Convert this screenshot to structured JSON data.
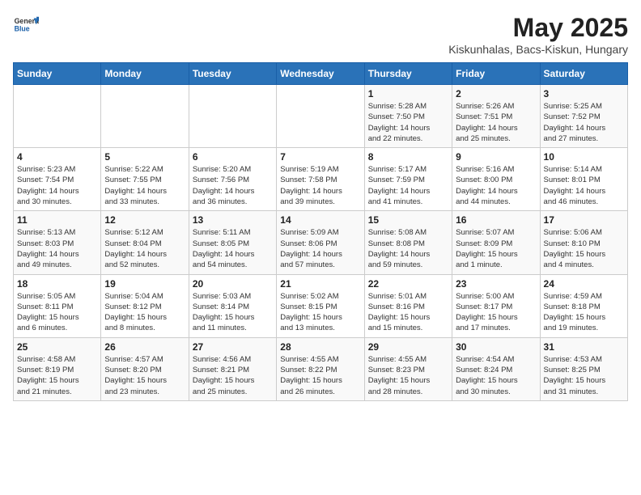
{
  "header": {
    "logo_general": "General",
    "logo_blue": "Blue",
    "month_year": "May 2025",
    "location": "Kiskunhalas, Bacs-Kiskun, Hungary"
  },
  "weekdays": [
    "Sunday",
    "Monday",
    "Tuesday",
    "Wednesday",
    "Thursday",
    "Friday",
    "Saturday"
  ],
  "weeks": [
    [
      {
        "day": "",
        "info": ""
      },
      {
        "day": "",
        "info": ""
      },
      {
        "day": "",
        "info": ""
      },
      {
        "day": "",
        "info": ""
      },
      {
        "day": "1",
        "info": "Sunrise: 5:28 AM\nSunset: 7:50 PM\nDaylight: 14 hours\nand 22 minutes."
      },
      {
        "day": "2",
        "info": "Sunrise: 5:26 AM\nSunset: 7:51 PM\nDaylight: 14 hours\nand 25 minutes."
      },
      {
        "day": "3",
        "info": "Sunrise: 5:25 AM\nSunset: 7:52 PM\nDaylight: 14 hours\nand 27 minutes."
      }
    ],
    [
      {
        "day": "4",
        "info": "Sunrise: 5:23 AM\nSunset: 7:54 PM\nDaylight: 14 hours\nand 30 minutes."
      },
      {
        "day": "5",
        "info": "Sunrise: 5:22 AM\nSunset: 7:55 PM\nDaylight: 14 hours\nand 33 minutes."
      },
      {
        "day": "6",
        "info": "Sunrise: 5:20 AM\nSunset: 7:56 PM\nDaylight: 14 hours\nand 36 minutes."
      },
      {
        "day": "7",
        "info": "Sunrise: 5:19 AM\nSunset: 7:58 PM\nDaylight: 14 hours\nand 39 minutes."
      },
      {
        "day": "8",
        "info": "Sunrise: 5:17 AM\nSunset: 7:59 PM\nDaylight: 14 hours\nand 41 minutes."
      },
      {
        "day": "9",
        "info": "Sunrise: 5:16 AM\nSunset: 8:00 PM\nDaylight: 14 hours\nand 44 minutes."
      },
      {
        "day": "10",
        "info": "Sunrise: 5:14 AM\nSunset: 8:01 PM\nDaylight: 14 hours\nand 46 minutes."
      }
    ],
    [
      {
        "day": "11",
        "info": "Sunrise: 5:13 AM\nSunset: 8:03 PM\nDaylight: 14 hours\nand 49 minutes."
      },
      {
        "day": "12",
        "info": "Sunrise: 5:12 AM\nSunset: 8:04 PM\nDaylight: 14 hours\nand 52 minutes."
      },
      {
        "day": "13",
        "info": "Sunrise: 5:11 AM\nSunset: 8:05 PM\nDaylight: 14 hours\nand 54 minutes."
      },
      {
        "day": "14",
        "info": "Sunrise: 5:09 AM\nSunset: 8:06 PM\nDaylight: 14 hours\nand 57 minutes."
      },
      {
        "day": "15",
        "info": "Sunrise: 5:08 AM\nSunset: 8:08 PM\nDaylight: 14 hours\nand 59 minutes."
      },
      {
        "day": "16",
        "info": "Sunrise: 5:07 AM\nSunset: 8:09 PM\nDaylight: 15 hours\nand 1 minute."
      },
      {
        "day": "17",
        "info": "Sunrise: 5:06 AM\nSunset: 8:10 PM\nDaylight: 15 hours\nand 4 minutes."
      }
    ],
    [
      {
        "day": "18",
        "info": "Sunrise: 5:05 AM\nSunset: 8:11 PM\nDaylight: 15 hours\nand 6 minutes."
      },
      {
        "day": "19",
        "info": "Sunrise: 5:04 AM\nSunset: 8:12 PM\nDaylight: 15 hours\nand 8 minutes."
      },
      {
        "day": "20",
        "info": "Sunrise: 5:03 AM\nSunset: 8:14 PM\nDaylight: 15 hours\nand 11 minutes."
      },
      {
        "day": "21",
        "info": "Sunrise: 5:02 AM\nSunset: 8:15 PM\nDaylight: 15 hours\nand 13 minutes."
      },
      {
        "day": "22",
        "info": "Sunrise: 5:01 AM\nSunset: 8:16 PM\nDaylight: 15 hours\nand 15 minutes."
      },
      {
        "day": "23",
        "info": "Sunrise: 5:00 AM\nSunset: 8:17 PM\nDaylight: 15 hours\nand 17 minutes."
      },
      {
        "day": "24",
        "info": "Sunrise: 4:59 AM\nSunset: 8:18 PM\nDaylight: 15 hours\nand 19 minutes."
      }
    ],
    [
      {
        "day": "25",
        "info": "Sunrise: 4:58 AM\nSunset: 8:19 PM\nDaylight: 15 hours\nand 21 minutes."
      },
      {
        "day": "26",
        "info": "Sunrise: 4:57 AM\nSunset: 8:20 PM\nDaylight: 15 hours\nand 23 minutes."
      },
      {
        "day": "27",
        "info": "Sunrise: 4:56 AM\nSunset: 8:21 PM\nDaylight: 15 hours\nand 25 minutes."
      },
      {
        "day": "28",
        "info": "Sunrise: 4:55 AM\nSunset: 8:22 PM\nDaylight: 15 hours\nand 26 minutes."
      },
      {
        "day": "29",
        "info": "Sunrise: 4:55 AM\nSunset: 8:23 PM\nDaylight: 15 hours\nand 28 minutes."
      },
      {
        "day": "30",
        "info": "Sunrise: 4:54 AM\nSunset: 8:24 PM\nDaylight: 15 hours\nand 30 minutes."
      },
      {
        "day": "31",
        "info": "Sunrise: 4:53 AM\nSunset: 8:25 PM\nDaylight: 15 hours\nand 31 minutes."
      }
    ]
  ]
}
